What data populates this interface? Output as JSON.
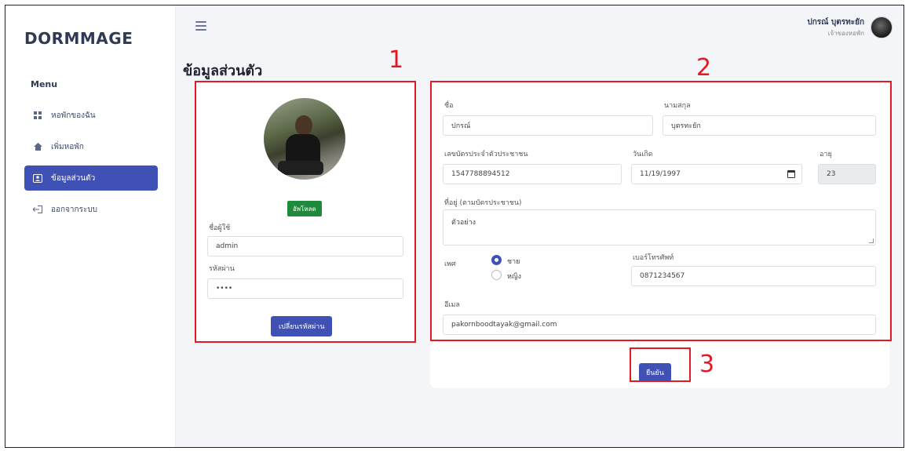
{
  "app": {
    "logo": "DORMMAGE"
  },
  "sidebar": {
    "menu_title": "Menu",
    "items": [
      {
        "label": "หอพักของฉัน",
        "icon": "grid-icon",
        "active": false
      },
      {
        "label": "เพิ่มหอพัก",
        "icon": "home-icon",
        "active": false
      },
      {
        "label": "ข้อมูลส่วนตัว",
        "icon": "user-card-icon",
        "active": true
      },
      {
        "label": "ออกจากระบบ",
        "icon": "logout-icon",
        "active": false
      }
    ]
  },
  "header": {
    "user_name": "ปกรณ์ บุตรทะยัก",
    "user_role": "เจ้าของหอพัก"
  },
  "page": {
    "title": "ข้อมูลส่วนตัว"
  },
  "annotations": {
    "one": "1",
    "two": "2",
    "three": "3"
  },
  "account": {
    "upload_label": "อัพโหลด",
    "username_label": "ชื่อผู้ใช้",
    "username_value": "admin",
    "password_label": "รหัสผ่าน",
    "password_value": "••••",
    "change_password_label": "เปลี่ยนรหัสผ่าน"
  },
  "profile": {
    "first_name_label": "ชื่อ",
    "first_name_value": "ปกรณ์",
    "last_name_label": "นามสกุล",
    "last_name_value": "บุตรทะยัก",
    "id_card_label": "เลขบัตรประจำตัวประชาชน",
    "id_card_value": "1547788894512",
    "birthdate_label": "วันเกิด",
    "birthdate_value": "11/19/1997",
    "age_label": "อายุ",
    "age_value": "23",
    "address_label": "ที่อยู่ (ตามบัตรประชาชน)",
    "address_value": "ตัวอย่าง",
    "gender_label": "เพศ",
    "gender_male": "ชาย",
    "gender_female": "หญิง",
    "phone_label": "เบอร์โทรศัพท์",
    "phone_value": "0871234567",
    "email_label": "อีเมล",
    "email_value": "pakornboodtayak@gmail.com",
    "confirm_label": "ยืนยัน"
  },
  "colors": {
    "accent": "#3f51b5",
    "upload": "#1e8a3c",
    "annotation": "#e01b24"
  }
}
